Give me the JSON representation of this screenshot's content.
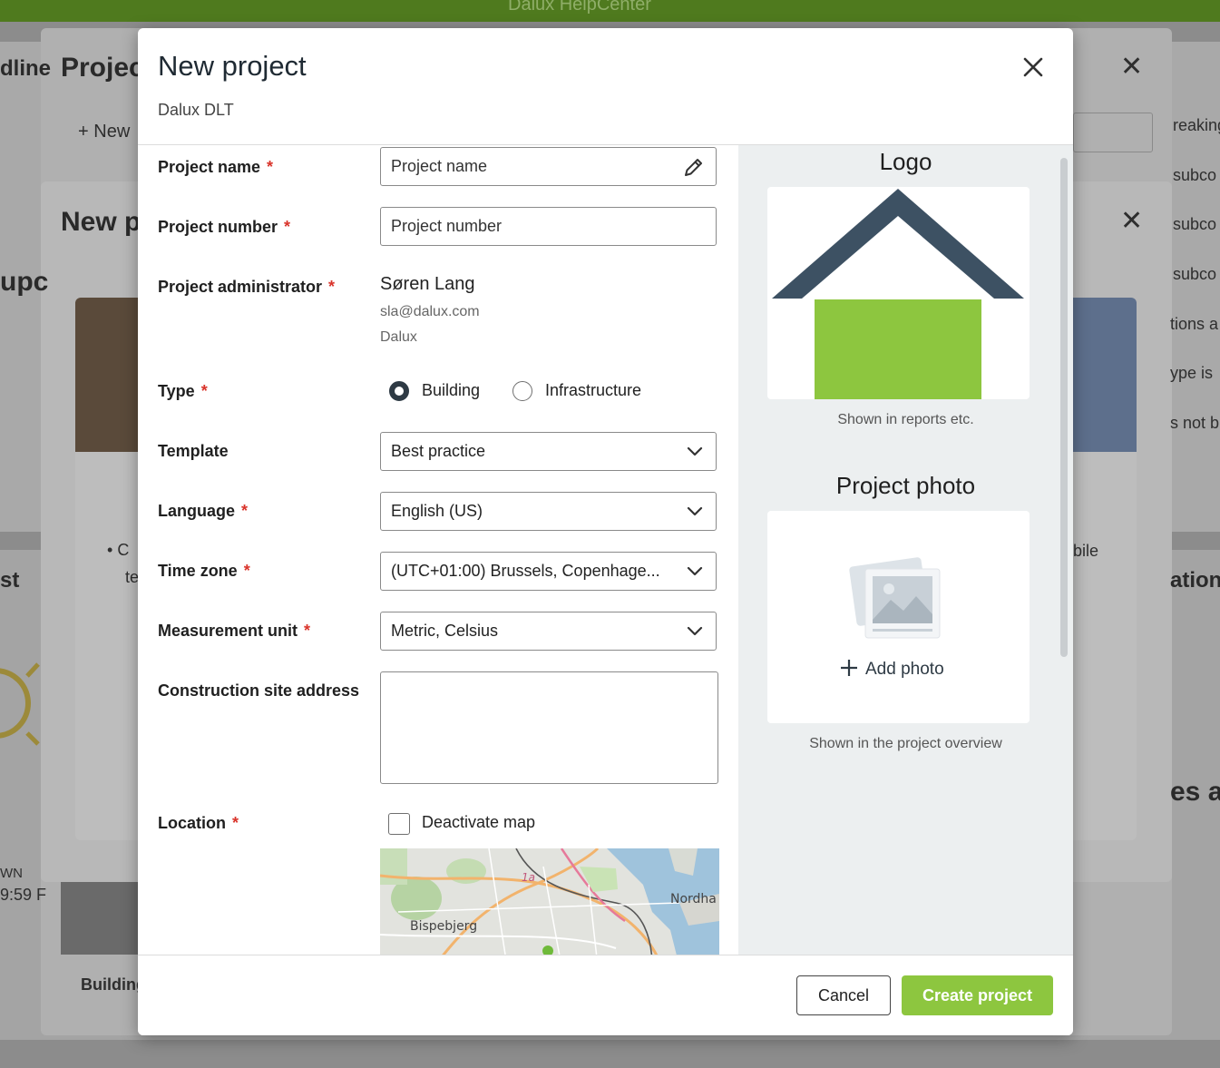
{
  "background": {
    "app_title": "Dalux HelpCenter",
    "left_edge_text": "dline",
    "panel1_title": "Projec",
    "panel1_new": "New",
    "panel2_title": "New p",
    "fragment_upc": "upc",
    "fragment_st": "st",
    "fragment_wn": "WN",
    "fragment_time": "9:59 F",
    "fragment_bullet": "C",
    "fragment_te": "te",
    "fragment_building": "Building",
    "right_items": [
      "reaking",
      "subco",
      "subco",
      "subco",
      "tions a",
      "ype is",
      "s not b"
    ],
    "right_mobile": "bile",
    "right_ation": "ation",
    "right_esa": "es a"
  },
  "modal": {
    "title": "New project",
    "subtitle": "Dalux DLT",
    "form": {
      "project_name_label": "Project name",
      "project_name_placeholder": "Project name",
      "project_number_label": "Project number",
      "project_number_placeholder": "Project number",
      "admin_label": "Project administrator",
      "admin_name": "Søren Lang",
      "admin_email": "sla@dalux.com",
      "admin_org": "Dalux",
      "type_label": "Type",
      "type_options": [
        "Building",
        "Infrastructure"
      ],
      "type_selected": "Building",
      "template_label": "Template",
      "template_value": "Best practice",
      "language_label": "Language",
      "language_value": "English (US)",
      "timezone_label": "Time zone",
      "timezone_value": "(UTC+01:00) Brussels, Copenhage...",
      "measurement_label": "Measurement unit",
      "measurement_value": "Metric, Celsius",
      "address_label": "Construction site address",
      "address_value": "",
      "location_label": "Location",
      "deactivate_map_label": "Deactivate map",
      "deactivate_map_checked": false,
      "map_labels": [
        "Nordha",
        "Bispebjerg",
        "1a"
      ]
    },
    "side": {
      "logo_title": "Logo",
      "logo_caption": "Shown in reports etc.",
      "photo_title": "Project photo",
      "add_photo_label": "Add photo",
      "photo_caption": "Shown in the project overview"
    },
    "footer": {
      "cancel_label": "Cancel",
      "create_label": "Create project"
    }
  },
  "colors": {
    "accent_green": "#8dc63f",
    "logo_roof": "#3d5163",
    "logo_body": "#8dc63f",
    "required_star": "#d9342b"
  }
}
